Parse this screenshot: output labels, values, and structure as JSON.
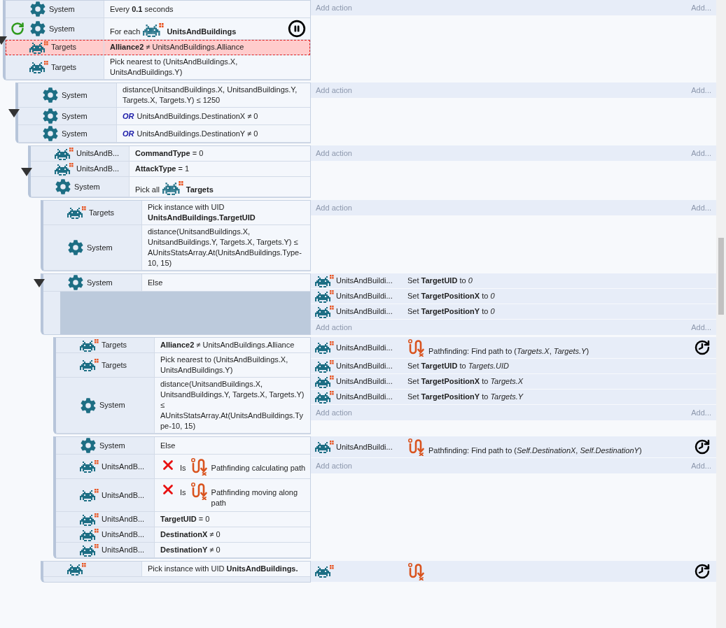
{
  "events": [
    {
      "expanded": true,
      "add_action": "Add action",
      "add_more": "Add...",
      "conditions": [
        {
          "object": {
            "kind": "system",
            "name": "System"
          },
          "kind": "plain",
          "text": "Every **0.1** seconds",
          "selected": false
        },
        {
          "object": {
            "kind": "system",
            "name": "System"
          },
          "kind": "pick",
          "lead": "For each",
          "target": "UnitsAndBuildings",
          "loop": true,
          "breakpoint": true,
          "selected": false
        },
        {
          "object": {
            "kind": "sprite",
            "name": "Targets"
          },
          "kind": "plain",
          "text": "**Alliance2** ≠ UnitsAndBuildings.Alliance",
          "selected": true
        },
        {
          "object": {
            "kind": "sprite",
            "name": "Targets"
          },
          "kind": "plain",
          "text": "Pick nearest to (UnitsAndBuildings.X, UnitsAndBuildings.Y)",
          "selected": false
        }
      ],
      "children": [
        {
          "expanded": true,
          "add_action": "Add action",
          "add_more": "Add...",
          "conditions": [
            {
              "object": {
                "kind": "system",
                "name": "System"
              },
              "kind": "plain",
              "text": "distance(UnitsandBuildings.X, UnitsandBuildings.Y, Targets.X, Targets.Y) ≤ 1250",
              "selected": false
            },
            {
              "object": {
                "kind": "system",
                "name": "System"
              },
              "kind": "plain",
              "connector": "OR",
              "text": "UnitsAndBuildings.DestinationX ≠ 0",
              "selected": false
            },
            {
              "object": {
                "kind": "system",
                "name": "System"
              },
              "kind": "plain",
              "connector": "OR",
              "text": "UnitsAndBuildings.DestinationY ≠ 0",
              "selected": false
            }
          ],
          "children": [
            {
              "expanded": true,
              "add_action": "Add action",
              "add_more": "Add...",
              "conditions": [
                {
                  "object": {
                    "kind": "sprite",
                    "name": "UnitsAndB..."
                  },
                  "kind": "plain",
                  "text": "**CommandType** = 0",
                  "selected": false
                },
                {
                  "object": {
                    "kind": "sprite",
                    "name": "UnitsAndB..."
                  },
                  "kind": "plain",
                  "text": "**AttackType** = 1",
                  "selected": false
                },
                {
                  "object": {
                    "kind": "system",
                    "name": "System"
                  },
                  "kind": "pick",
                  "lead": "Pick all",
                  "target": "Targets",
                  "selected": false
                }
              ],
              "children": [
                {
                  "add_action": "Add action",
                  "add_more": "Add...",
                  "conditions": [
                    {
                      "object": {
                        "kind": "sprite",
                        "name": "Targets"
                      },
                      "kind": "plain",
                      "text": "Pick instance with UID **UnitsAndBuildings.TargetUID**",
                      "selected": false
                    },
                    {
                      "object": {
                        "kind": "system",
                        "name": "System"
                      },
                      "kind": "plain",
                      "text": "distance(UnitsandBuildings.X, UnitsandBuildings.Y, Targets.X, Targets.Y) ≤ AUnitsStatsArray.At(UnitsAndBuildings.Type-10, 15)",
                      "selected": false
                    }
                  ]
                },
                {
                  "expanded": true,
                  "add_action": "Add action",
                  "add_more": "Add...",
                  "conditions": [
                    {
                      "object": {
                        "kind": "system",
                        "name": "System"
                      },
                      "kind": "plain",
                      "text": "Else",
                      "selected": false
                    }
                  ],
                  "actions": [
                    {
                      "object": "UnitsAndBuildi...",
                      "kind": "plain",
                      "text": "Set **TargetUID** to *0*"
                    },
                    {
                      "object": "UnitsAndBuildi...",
                      "kind": "plain",
                      "text": "Set **TargetPositionX** to *0*"
                    },
                    {
                      "object": "UnitsAndBuildi...",
                      "kind": "plain",
                      "text": "Set **TargetPositionY** to *0*"
                    }
                  ],
                  "children": [
                    {
                      "add_action": "Add action",
                      "add_more": "Add...",
                      "conditions": [
                        {
                          "object": {
                            "kind": "sprite",
                            "name": "Targets"
                          },
                          "kind": "plain",
                          "text": "**Alliance2** ≠ UnitsAndBuildings.Alliance",
                          "selected": false
                        },
                        {
                          "object": {
                            "kind": "sprite",
                            "name": "Targets"
                          },
                          "kind": "plain",
                          "text": "Pick nearest to (UnitsAndBuildings.X, UnitsAndBuildings.Y)",
                          "selected": false
                        },
                        {
                          "object": {
                            "kind": "system",
                            "name": "System"
                          },
                          "kind": "plain",
                          "text": "distance(UnitsandBuildings.X, UnitsandBuildings.Y, Targets.X, Targets.Y) ≤ AUnitsStatsArray.At(UnitsAndBuildings.Type-10, 15)",
                          "selected": false
                        }
                      ],
                      "actions": [
                        {
                          "object": "UnitsAndBuildi...",
                          "kind": "behavior",
                          "async": true,
                          "text": "Pathfinding: Find path to (*Targets.X*, *Targets.Y*)"
                        },
                        {
                          "object": "UnitsAndBuildi...",
                          "kind": "plain",
                          "text": "Set **TargetUID** to *Targets.UID*"
                        },
                        {
                          "object": "UnitsAndBuildi...",
                          "kind": "plain",
                          "text": "Set **TargetPositionX** to *Targets.X*"
                        },
                        {
                          "object": "UnitsAndBuildi...",
                          "kind": "plain",
                          "text": "Set **TargetPositionY** to *Targets.Y*"
                        }
                      ]
                    },
                    {
                      "add_action": "Add action",
                      "add_more": "Add...",
                      "conditions": [
                        {
                          "object": {
                            "kind": "system",
                            "name": "System"
                          },
                          "kind": "plain",
                          "text": "Else",
                          "selected": false
                        },
                        {
                          "object": {
                            "kind": "sprite",
                            "name": "UnitsAndB..."
                          },
                          "kind": "behavior",
                          "inverted": true,
                          "lead": "Is",
                          "text": "Pathfinding calculating path",
                          "selected": false
                        },
                        {
                          "object": {
                            "kind": "sprite",
                            "name": "UnitsAndB..."
                          },
                          "kind": "behavior",
                          "inverted": true,
                          "lead": "Is",
                          "text": "Pathfinding moving along path",
                          "selected": false
                        },
                        {
                          "object": {
                            "kind": "sprite",
                            "name": "UnitsAndB..."
                          },
                          "kind": "plain",
                          "text": "**TargetUID** = 0",
                          "selected": false
                        },
                        {
                          "object": {
                            "kind": "sprite",
                            "name": "UnitsAndB..."
                          },
                          "kind": "plain",
                          "text": "**DestinationX** ≠ 0",
                          "selected": false
                        },
                        {
                          "object": {
                            "kind": "sprite",
                            "name": "UnitsAndB..."
                          },
                          "kind": "plain",
                          "text": "**DestinationY** ≠ 0",
                          "selected": false
                        }
                      ],
                      "actions": [
                        {
                          "object": "UnitsAndBuildi...",
                          "kind": "behavior",
                          "async": true,
                          "text": "Pathfinding: Find path to (*Self.DestinationX*, *Self.DestinationY*)"
                        }
                      ]
                    }
                  ]
                },
                {
                  "conditions": [
                    {
                      "object": {
                        "kind": "sprite"
                      },
                      "kind": "plain",
                      "text": "Pick instance with UID **UnitsAndBuildings.**",
                      "selected": false
                    }
                  ],
                  "actions": [
                    {
                      "kind": "behavior",
                      "async": true
                    }
                  ]
                }
              ]
            }
          ]
        }
      ]
    }
  ]
}
